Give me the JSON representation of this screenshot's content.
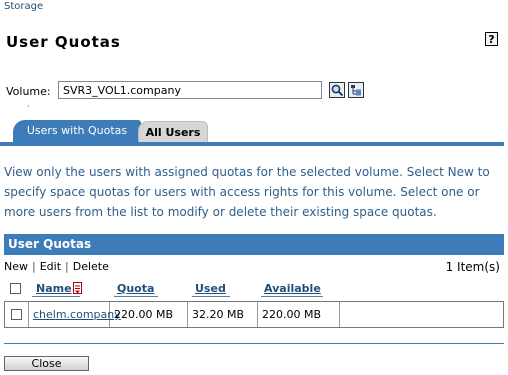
{
  "breadcrumb": "Storage",
  "page_title": "User Quotas",
  "help_label": "?",
  "volume": {
    "label": "Volume:",
    "value": "SVR3_VOL1.company"
  },
  "tabs": [
    {
      "label": "Users with Quotas",
      "active": true
    },
    {
      "label": "All Users",
      "active": false
    }
  ],
  "description": "View only the users with assigned quotas for the selected volume. Select New to specify space quotas for users with access rights for this volume. Select one or more users from the list to modify or delete their existing space quotas.",
  "grid": {
    "title": "User Quotas",
    "toolbar": {
      "new_label": "New",
      "edit_label": "Edit",
      "delete_label": "Delete",
      "item_count": "1 Item(s)"
    },
    "columns": [
      "Name",
      "Quota",
      "Used",
      "Available"
    ],
    "rows": [
      {
        "name": "chelm.company",
        "quota": "220.00 MB",
        "used": "32.20 MB",
        "available": "220.00 MB"
      }
    ]
  },
  "close_label": "Close",
  "colors": {
    "accent": "#3d7cb8",
    "link": "#1f4f7a",
    "description_text": "#2f5f8c"
  }
}
